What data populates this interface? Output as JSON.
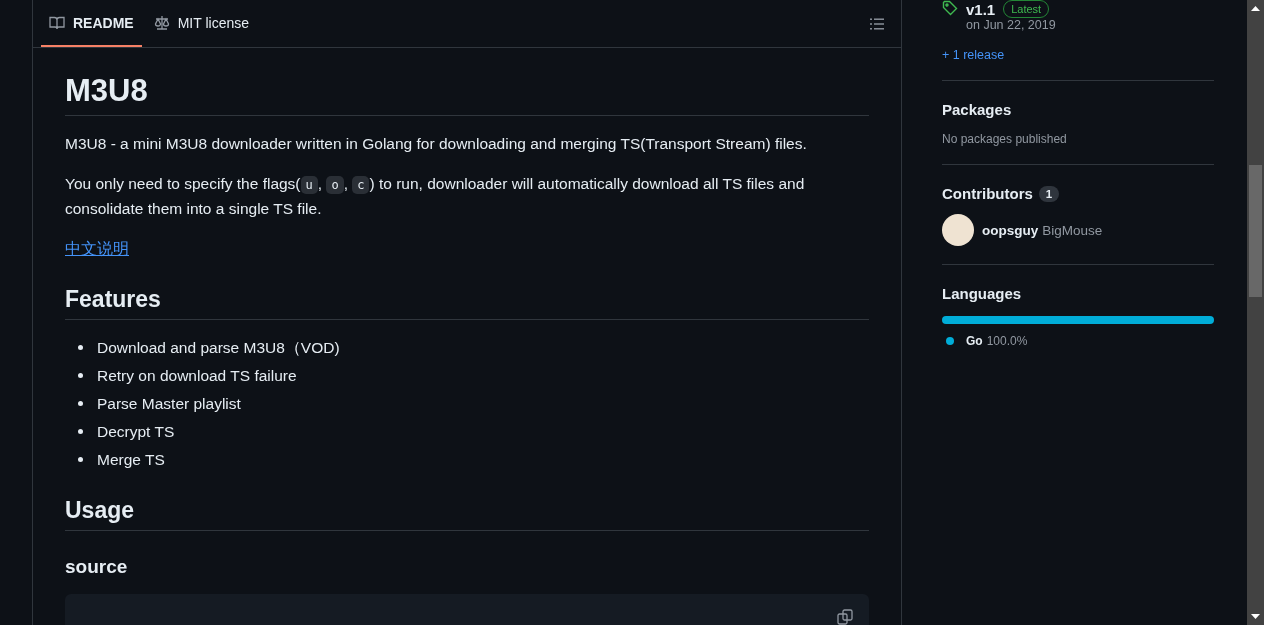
{
  "tabs": [
    {
      "label": "README",
      "kind": "readme",
      "selected": true
    },
    {
      "label": "MIT license",
      "kind": "license",
      "selected": false
    }
  ],
  "readme": {
    "title": "M3U8",
    "intro": "M3U8 - a mini M3U8 downloader written in Golang for downloading and merging TS(Transport Stream) files.",
    "flags_paragraph": [
      {
        "kind": "text",
        "text": "You only need to specify the flags("
      },
      {
        "kind": "code",
        "text": "u"
      },
      {
        "kind": "text",
        "text": ", "
      },
      {
        "kind": "code",
        "text": "o"
      },
      {
        "kind": "text",
        "text": ", "
      },
      {
        "kind": "code",
        "text": "c"
      },
      {
        "kind": "text",
        "text": ") to run, downloader will automatically download all TS files and consolidate them into a single TS file."
      }
    ],
    "link": "中文说明",
    "features_heading": "Features",
    "features": [
      "Download and parse M3U8（VOD)",
      "Retry on download TS failure",
      "Parse Master playlist",
      "Decrypt TS",
      "Merge TS"
    ],
    "usage_heading": "Usage",
    "source_heading": "source"
  },
  "sidebar": {
    "release": {
      "tag": "v1.1",
      "badge": "Latest",
      "date": "on Jun 22, 2019"
    },
    "more_releases": "+ 1 release",
    "packages": {
      "title": "Packages",
      "note": "No packages published"
    },
    "contributors": {
      "title": "Contributors",
      "count": "1",
      "people": [
        {
          "login": "oopsguy",
          "name": "BigMouse"
        }
      ]
    },
    "languages": {
      "title": "Languages",
      "items": [
        {
          "name": "Go",
          "percent": "100.0%",
          "level": 1.0,
          "color": "#00add8"
        }
      ]
    }
  }
}
